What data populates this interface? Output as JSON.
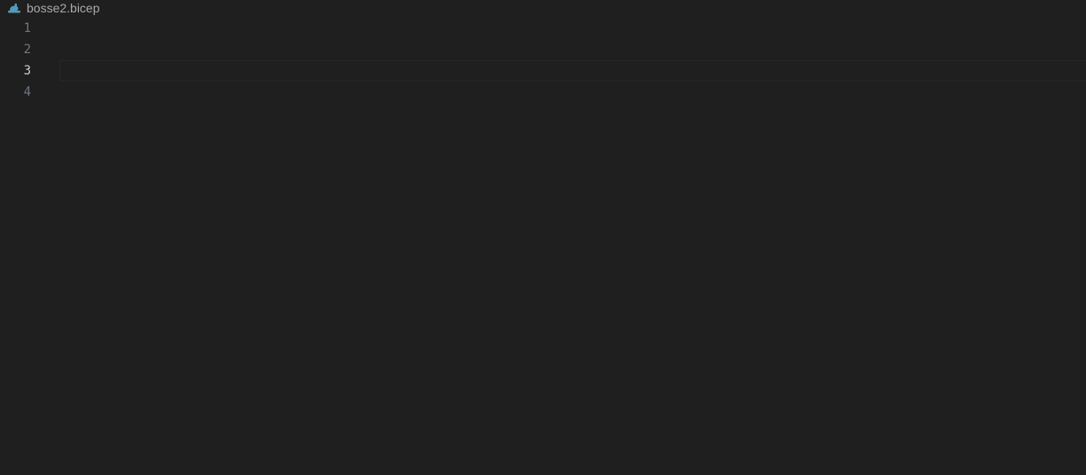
{
  "editor": {
    "file": {
      "name": "bosse2.bicep",
      "icon": "bicep-file-icon"
    },
    "lines": [
      {
        "number": "1",
        "text": ""
      },
      {
        "number": "2",
        "text": ""
      },
      {
        "number": "3",
        "text": ""
      },
      {
        "number": "4",
        "text": ""
      }
    ],
    "current_line": 3
  },
  "colors": {
    "background": "#1f1f1f",
    "line_number": "#6e7681",
    "active_line_number": "#cccccc",
    "file_name": "#a9a9a9",
    "icon_accent": "#519aba"
  }
}
